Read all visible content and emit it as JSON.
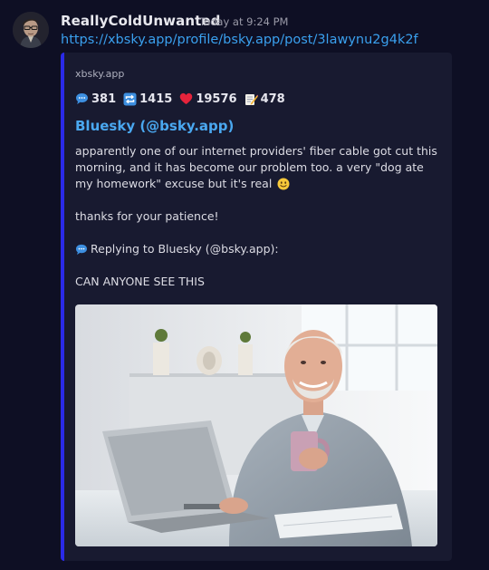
{
  "message": {
    "author": "ReallyColdUnwanted",
    "timestamp": "Today at 9:24 PM",
    "link": "https://xbsky.app/profile/bsky.app/post/3lawynu2g4k2f"
  },
  "embed": {
    "provider": "xbsky.app",
    "stats": {
      "replies": "381",
      "reposts": "1415",
      "likes": "19576",
      "quotes": "478"
    },
    "title": "Bluesky (@bsky.app)",
    "description": {
      "paragraph1": "apparently one of our internet providers' fiber cable got cut this morning, and it has become our problem too. a very \"dog ate my homework\" excuse but it's real",
      "paragraph2": "thanks for your patience!",
      "reply_label": "Replying to Bluesky (@bsky.app):",
      "quoted_text": "CAN ANYONE SEE THIS"
    },
    "image_icon": "photo-of-smiling-man-at-laptop"
  },
  "icons": {
    "replies": "speech-bubble-icon",
    "reposts": "repeat-icon",
    "likes": "heart-icon",
    "quotes": "memo-icon",
    "smile": "smiling-face-icon"
  },
  "colors": {
    "background": "#0e0f24",
    "embed_bg": "#181a30",
    "embed_accent": "#2a2ae8",
    "link": "#3aa0ee",
    "title": "#4aa8f0"
  }
}
